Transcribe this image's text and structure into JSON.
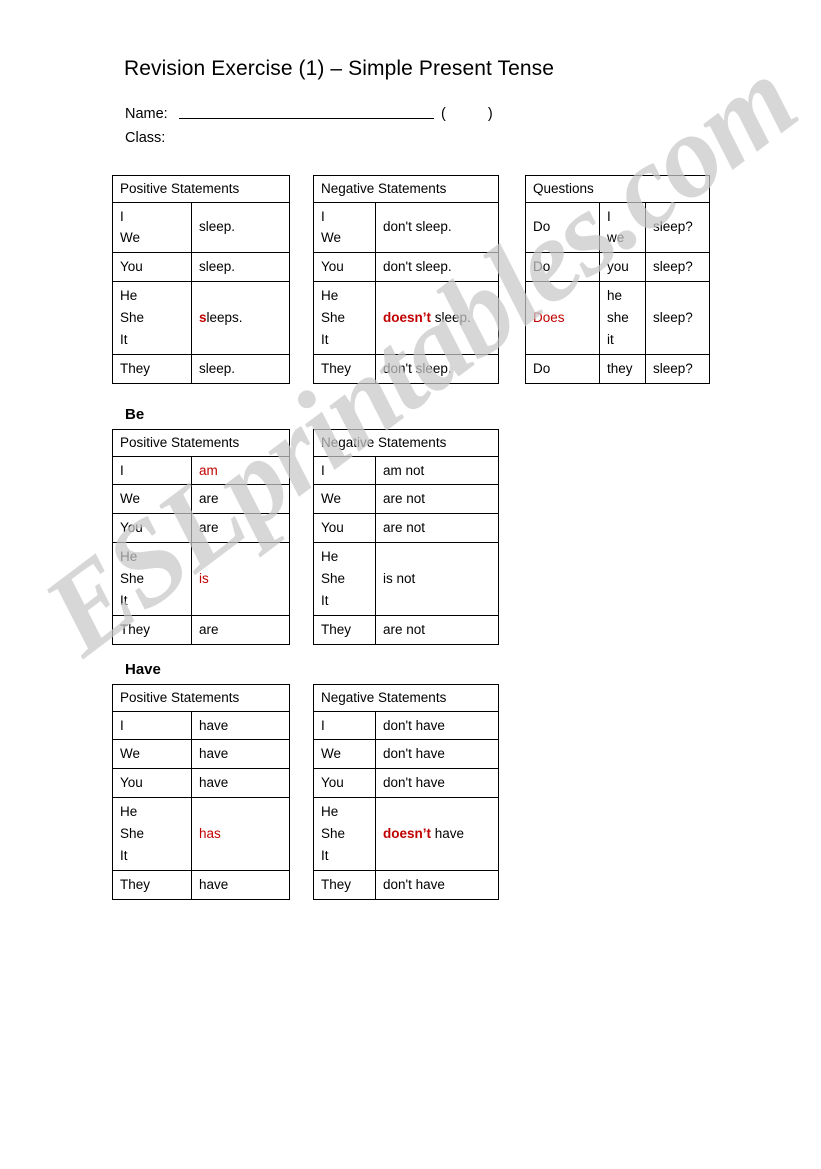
{
  "page": {
    "title": "Revision Exercise (1) – Simple Present Tense",
    "watermark": "ESLprintables.com"
  },
  "fields": {
    "name_label": "Name:",
    "class_label": "Class:",
    "paren_open": "(",
    "paren_close": ")",
    "name_value": ""
  },
  "colors": {
    "highlight_red": "#C00000",
    "border": "#000000",
    "watermark_gray": "#C9C9C9"
  },
  "sections": [
    {
      "id": "do",
      "label": "",
      "tables": [
        {
          "id": "do-positive",
          "header": "Positive Statements",
          "columns": 2,
          "rows": [
            {
              "subjects": [
                "I",
                "We"
              ],
              "cells": [
                "sleep."
              ]
            },
            {
              "subjects": [
                "You"
              ],
              "cells": [
                "sleep."
              ]
            },
            {
              "subjects": [
                "He",
                "She",
                "It"
              ],
              "cells": [
                "sleeps."
              ],
              "highlight": "s"
            },
            {
              "subjects": [
                "They"
              ],
              "cells": [
                "sleep."
              ]
            }
          ]
        },
        {
          "id": "do-negative",
          "header": "Negative Statements",
          "columns": 2,
          "rows": [
            {
              "subjects": [
                "I",
                "We"
              ],
              "cells": [
                "don't sleep."
              ]
            },
            {
              "subjects": [
                "You"
              ],
              "cells": [
                "don't sleep."
              ]
            },
            {
              "subjects": [
                "He",
                "She",
                "It"
              ],
              "cells": [
                "doesn’t sleep."
              ],
              "highlight": "doesn’t"
            },
            {
              "subjects": [
                "They"
              ],
              "cells": [
                "don't sleep."
              ]
            }
          ]
        },
        {
          "id": "do-questions",
          "header": "Questions",
          "columns": 3,
          "rows": [
            {
              "aux": "Do",
              "subjects": [
                "I",
                "we"
              ],
              "verb": "sleep?"
            },
            {
              "aux": "Do",
              "subjects": [
                "you"
              ],
              "verb": "sleep?"
            },
            {
              "aux": "Does",
              "aux_highlight": true,
              "subjects": [
                "he",
                "she",
                "it"
              ],
              "verb": "sleep?"
            },
            {
              "aux": "Do",
              "subjects": [
                "they"
              ],
              "verb": "sleep?"
            }
          ]
        }
      ]
    },
    {
      "id": "be",
      "label": "Be",
      "tables": [
        {
          "id": "be-positive",
          "header": "Positive Statements",
          "columns": 2,
          "rows": [
            {
              "subjects": [
                "I"
              ],
              "cells": [
                "am"
              ],
              "highlight": "am"
            },
            {
              "subjects": [
                "We"
              ],
              "cells": [
                "are"
              ]
            },
            {
              "subjects": [
                "You"
              ],
              "cells": [
                "are"
              ]
            },
            {
              "subjects": [
                "He",
                "She",
                "It"
              ],
              "cells": [
                "is"
              ],
              "highlight": "is"
            },
            {
              "subjects": [
                "They"
              ],
              "cells": [
                "are"
              ]
            }
          ]
        },
        {
          "id": "be-negative",
          "header": "Negative Statements",
          "columns": 2,
          "rows": [
            {
              "subjects": [
                "I"
              ],
              "cells": [
                "am not"
              ]
            },
            {
              "subjects": [
                "We"
              ],
              "cells": [
                "are not"
              ]
            },
            {
              "subjects": [
                "You"
              ],
              "cells": [
                "are not"
              ]
            },
            {
              "subjects": [
                "He",
                "She",
                "It"
              ],
              "cells": [
                "is not"
              ]
            },
            {
              "subjects": [
                "They"
              ],
              "cells": [
                "are not"
              ]
            }
          ]
        }
      ]
    },
    {
      "id": "have",
      "label": "Have",
      "tables": [
        {
          "id": "have-positive",
          "header": "Positive Statements",
          "columns": 2,
          "rows": [
            {
              "subjects": [
                "I"
              ],
              "cells": [
                "have"
              ]
            },
            {
              "subjects": [
                "We"
              ],
              "cells": [
                "have"
              ]
            },
            {
              "subjects": [
                "You"
              ],
              "cells": [
                "have"
              ]
            },
            {
              "subjects": [
                "He",
                "She",
                "It"
              ],
              "cells": [
                "has"
              ],
              "highlight": "has"
            },
            {
              "subjects": [
                "They"
              ],
              "cells": [
                "have"
              ]
            }
          ]
        },
        {
          "id": "have-negative",
          "header": "Negative Statements",
          "columns": 2,
          "rows": [
            {
              "subjects": [
                "I"
              ],
              "cells": [
                "don't have"
              ]
            },
            {
              "subjects": [
                "We"
              ],
              "cells": [
                "don't have"
              ]
            },
            {
              "subjects": [
                "You"
              ],
              "cells": [
                "don't have"
              ]
            },
            {
              "subjects": [
                "He",
                "She",
                "It"
              ],
              "cells": [
                "doesn’t have"
              ],
              "highlight": "doesn’t"
            },
            {
              "subjects": [
                "They"
              ],
              "cells": [
                "don't have"
              ]
            }
          ]
        }
      ]
    }
  ]
}
